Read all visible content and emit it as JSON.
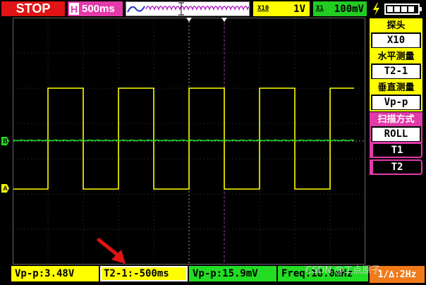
{
  "status": {
    "run_state": "STOP"
  },
  "timebase": {
    "prefix": "H",
    "value": "500ms"
  },
  "channel1": {
    "coupling_tag": "X10",
    "volts_div": "1V",
    "color": "#ffff00",
    "marker": "A",
    "vpp": "Vp-p:3.48V"
  },
  "channel2": {
    "coupling_tag": "X1",
    "volts_div": "100mV",
    "color": "#22dd22",
    "marker": "B",
    "vpp": "Vp-p:15.9mV",
    "freq": "Freq:18.0mHz"
  },
  "cursor_readout": "T2-1:-500ms",
  "bottom_right_freq": "1/∆:2Hz",
  "menu": {
    "probe": {
      "label": "探头",
      "value": "X10"
    },
    "h_measure": {
      "label": "水平测量",
      "value": "T2-1"
    },
    "v_measure": {
      "label": "垂直测量",
      "value": "Vp-p"
    },
    "scan_mode": {
      "label": "扫描方式",
      "value": "ROLL"
    },
    "t1": "T1",
    "t2": "T2"
  },
  "trigger_icon": "lightning-trigger-icon",
  "battery_icon": "battery-full-icon",
  "watermark": "CSDN @工点原子",
  "colors": {
    "stop_bg": "#e01414",
    "accent_magenta": "#e23aa8",
    "ch1": "#ffff00",
    "ch2": "#22dd22",
    "orange": "#f07a1a"
  }
}
